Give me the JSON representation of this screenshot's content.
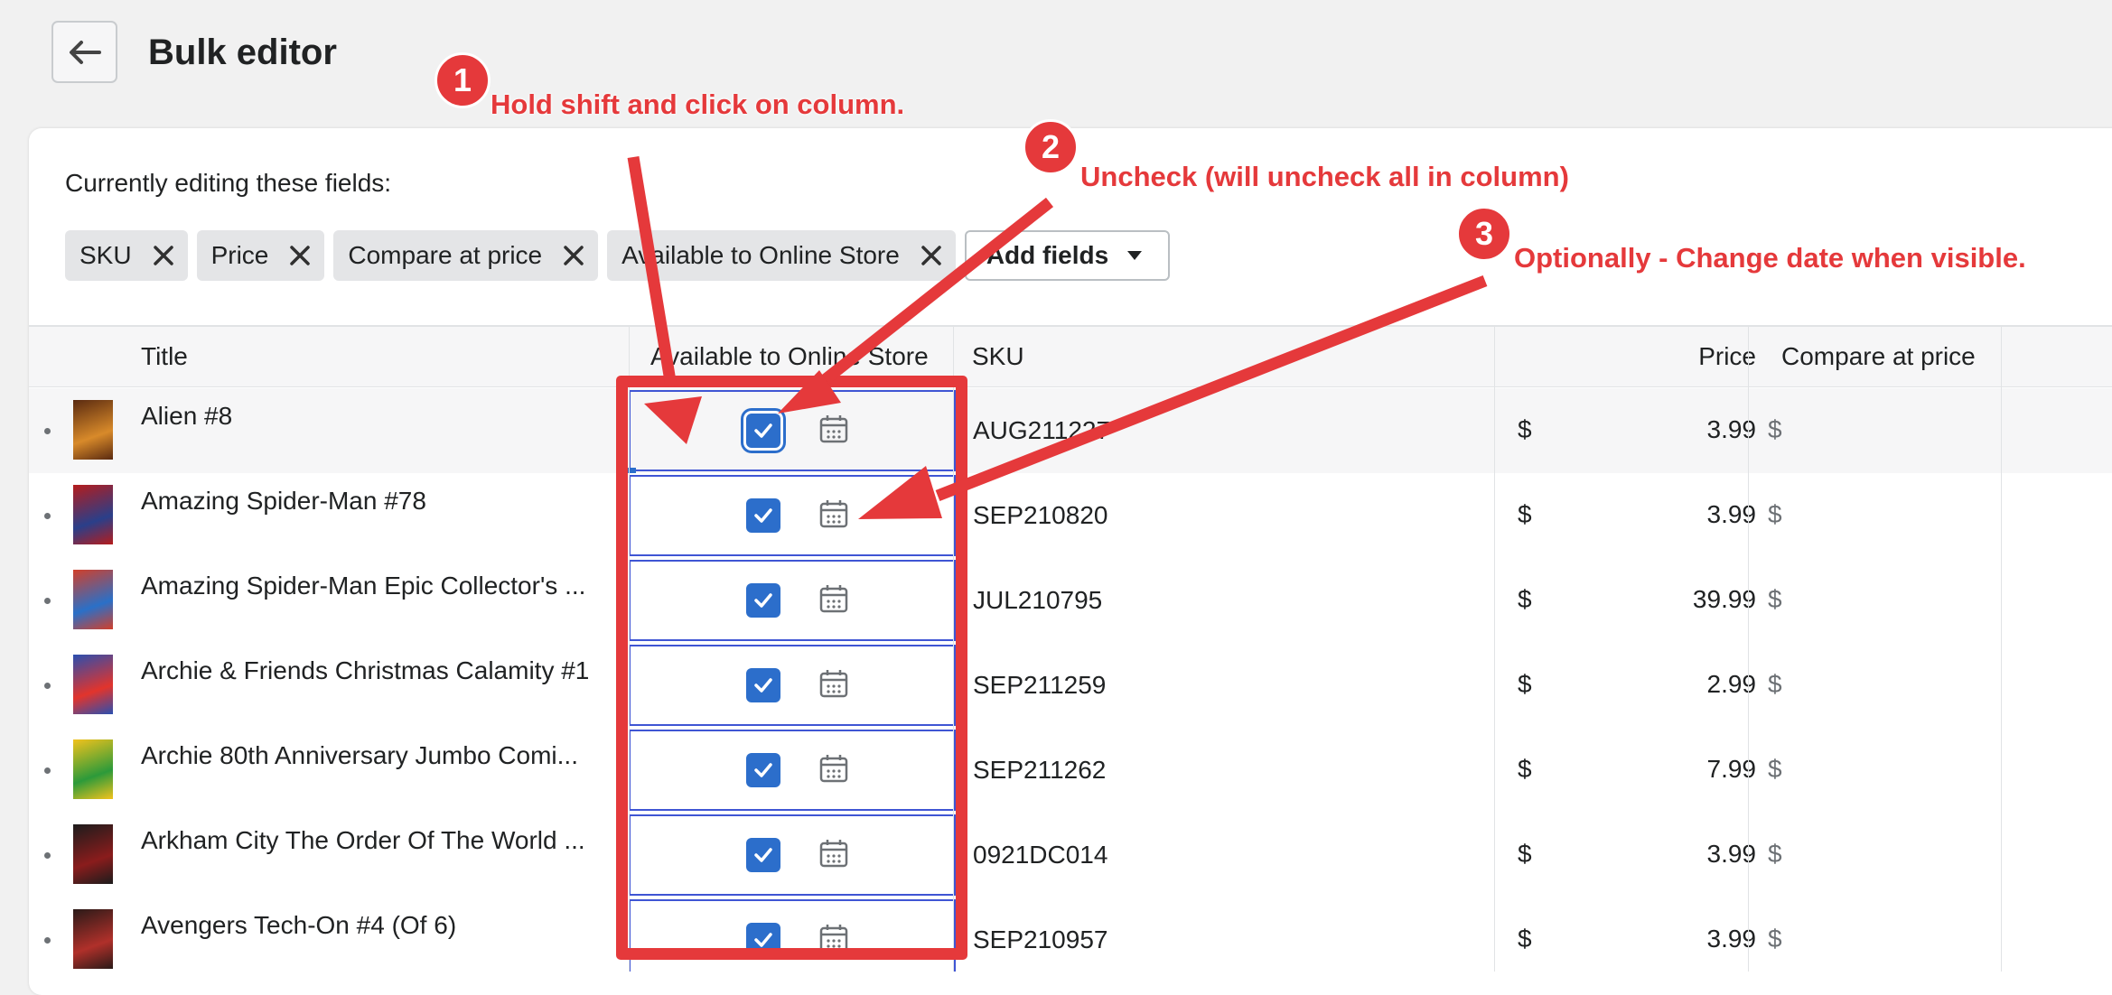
{
  "header": {
    "title": "Bulk editor",
    "back_icon": "arrow-left-icon"
  },
  "fields": {
    "label": "Currently editing these fields:",
    "chips": [
      {
        "label": "SKU"
      },
      {
        "label": "Price"
      },
      {
        "label": "Compare at price"
      },
      {
        "label": "Available to Online Store"
      }
    ],
    "add_button": "Add fields"
  },
  "table": {
    "columns": [
      "Title",
      "Available to Online Store",
      "SKU",
      "Price",
      "Compare at price"
    ],
    "rows": [
      {
        "title": "Alien #8",
        "available": true,
        "sku": "AUG211227",
        "currency": "$",
        "price": "3.99",
        "compare_currency": "$"
      },
      {
        "title": "Amazing Spider-Man #78",
        "available": true,
        "sku": "SEP210820",
        "currency": "$",
        "price": "3.99",
        "compare_currency": "$"
      },
      {
        "title": "Amazing Spider-Man Epic Collector's ...",
        "available": true,
        "sku": "JUL210795",
        "currency": "$",
        "price": "39.99",
        "compare_currency": "$"
      },
      {
        "title": "Archie & Friends Christmas Calamity #1",
        "available": true,
        "sku": "SEP211259",
        "currency": "$",
        "price": "2.99",
        "compare_currency": "$"
      },
      {
        "title": "Archie 80th Anniversary Jumbo Comi...",
        "available": true,
        "sku": "SEP211262",
        "currency": "$",
        "price": "7.99",
        "compare_currency": "$"
      },
      {
        "title": "Arkham City The Order Of The World ...",
        "available": true,
        "sku": "0921DC014",
        "currency": "$",
        "price": "3.99",
        "compare_currency": "$"
      },
      {
        "title": "Avengers Tech-On #4 (Of 6)",
        "available": true,
        "sku": "SEP210957",
        "currency": "$",
        "price": "3.99",
        "compare_currency": "$"
      }
    ]
  },
  "annotations": [
    {
      "number": "1",
      "text": "Hold shift and click on column."
    },
    {
      "number": "2",
      "text": "Uncheck (will uncheck all in column)"
    },
    {
      "number": "3",
      "text": "Optionally - Change date when visible."
    }
  ],
  "colors": {
    "annotation": "#e5393b",
    "checkbox": "#2c6ecb",
    "selection": "#3f55d4"
  }
}
